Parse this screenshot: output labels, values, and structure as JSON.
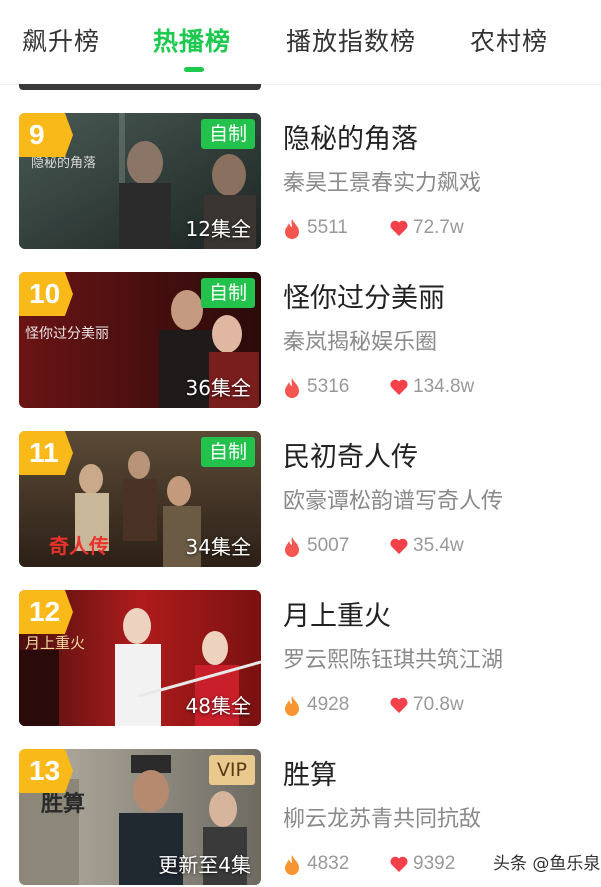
{
  "tabs": [
    {
      "label": "飙升榜",
      "active": false
    },
    {
      "label": "热播榜",
      "active": true
    },
    {
      "label": "播放指数榜",
      "active": false
    },
    {
      "label": "农村榜",
      "active": false
    }
  ],
  "colors": {
    "accent": "#1ec94f",
    "rank": "#f9b918",
    "fire": "#f4574f",
    "fire_orange": "#f79533",
    "heart": "#f2414b"
  },
  "items": [
    {
      "rank": "9",
      "badge": "自制",
      "episodes": "12集全",
      "title": "隐秘的角落",
      "desc": "秦昊王景春实力飙戏",
      "heat": "5511",
      "likes": "72.7w",
      "poster_text": "隐秘的角落"
    },
    {
      "rank": "10",
      "badge": "自制",
      "episodes": "36集全",
      "title": "怪你过分美丽",
      "desc": "秦岚揭秘娱乐圈",
      "heat": "5316",
      "likes": "134.8w",
      "poster_text": "怪你过分美丽"
    },
    {
      "rank": "11",
      "badge": "自制",
      "episodes": "34集全",
      "title": "民初奇人传",
      "desc": "欧豪谭松韵谱写奇人传",
      "heat": "5007",
      "likes": "35.4w",
      "poster_text": "奇人传"
    },
    {
      "rank": "12",
      "badge": "",
      "episodes": "48集全",
      "title": "月上重火",
      "desc": "罗云熙陈钰琪共筑江湖",
      "heat": "4928",
      "likes": "70.8w",
      "poster_text": "月上重火"
    },
    {
      "rank": "13",
      "badge": "VIP",
      "episodes": "更新至4集",
      "title": "胜算",
      "desc": "柳云龙苏青共同抗敌",
      "heat": "4832",
      "likes": "9392",
      "poster_text": "胜算"
    }
  ],
  "icons": {
    "heat": "fire-icon",
    "likes": "heart-icon"
  },
  "watermark": "头条 @鱼乐泉"
}
